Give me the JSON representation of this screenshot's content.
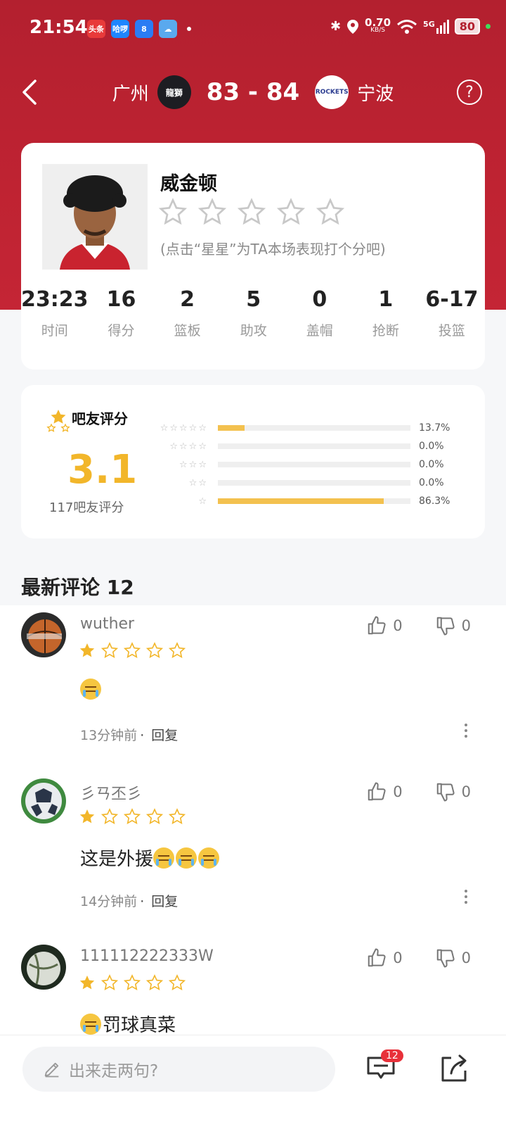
{
  "status_bar": {
    "time": "21:54",
    "net_speed": "0.70",
    "net_unit": "KB/S",
    "network": "5G",
    "battery": "80",
    "apps": [
      {
        "name": "toutiao-app-icon",
        "label": "头条",
        "color": "#e83a3a"
      },
      {
        "name": "hello-app-icon",
        "label": "哈啰",
        "color": "#1f86ff"
      },
      {
        "name": "eight-app-icon",
        "label": "8",
        "color": "#2b7cf4"
      },
      {
        "name": "weather-app-icon",
        "label": "",
        "color": "#5aa9ee"
      }
    ]
  },
  "header": {
    "home_team": "广州",
    "home_logo": "龍獅",
    "score": "83 - 84",
    "away_team": "宁波",
    "away_logo": "ROCKETS",
    "help": "?"
  },
  "player": {
    "name": "威金顿",
    "rating_hint": "(点击“星星”为TA本场表现打个分吧)",
    "stats": [
      {
        "value": "23:23",
        "label": "时间"
      },
      {
        "value": "16",
        "label": "得分"
      },
      {
        "value": "2",
        "label": "篮板"
      },
      {
        "value": "5",
        "label": "助攻"
      },
      {
        "value": "0",
        "label": "盖帽"
      },
      {
        "value": "1",
        "label": "抢断"
      },
      {
        "value": "6-17",
        "label": "投篮"
      }
    ]
  },
  "fan_rating": {
    "title": "吧友评分",
    "score": "3.1",
    "count_label": "117吧友评分",
    "distribution": [
      {
        "stars": "☆☆☆☆☆",
        "pct": "13.7%",
        "fraction": 0.137
      },
      {
        "stars": "☆☆☆☆",
        "pct": "0.0%",
        "fraction": 0.0
      },
      {
        "stars": "☆☆☆",
        "pct": "0.0%",
        "fraction": 0.0
      },
      {
        "stars": "☆☆",
        "pct": "0.0%",
        "fraction": 0.0
      },
      {
        "stars": "☆",
        "pct": "86.3%",
        "fraction": 0.863
      }
    ],
    "accent": "#f2b62a"
  },
  "comments_section": {
    "title": "最新评论 12",
    "comments": [
      {
        "user": "wuther",
        "rating": 1,
        "text": "",
        "emoji_count": 1,
        "time": "13分钟前",
        "reply": "回复",
        "likes": "0",
        "dislikes": "0"
      },
      {
        "user": "彡ㄢ丕彡",
        "rating": 1,
        "text": "这是外援",
        "emoji_count": 3,
        "time": "14分钟前",
        "reply": "回复",
        "likes": "0",
        "dislikes": "0"
      },
      {
        "user": "111112222333W",
        "rating": 1,
        "text": "罚球真菜",
        "emoji_count": 1,
        "emoji_first": true,
        "time": "",
        "reply": "",
        "likes": "0",
        "dislikes": "0"
      }
    ]
  },
  "bottom_bar": {
    "input_placeholder": "出来走两句?",
    "comment_badge": "12"
  }
}
